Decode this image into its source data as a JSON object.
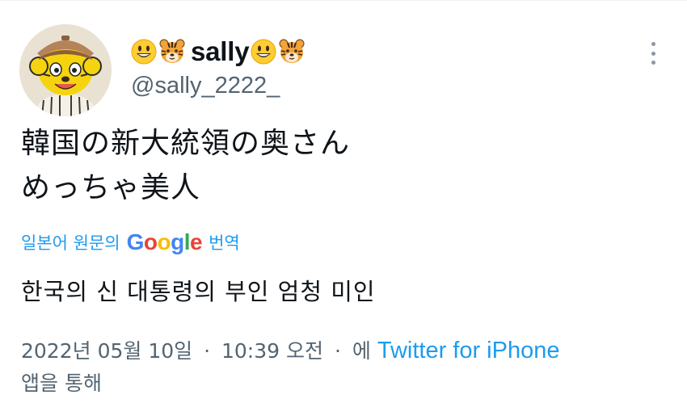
{
  "author": {
    "display_name": "sally",
    "handle": "@sally_2222_",
    "emoji_before": [
      "smiling-face-icon",
      "tiger-face-icon"
    ],
    "emoji_after": [
      "smiling-face-icon",
      "tiger-face-icon"
    ]
  },
  "tweet": {
    "lines": [
      "韓国の新大統領の奥さん",
      "めっちゃ美人"
    ]
  },
  "translation": {
    "prefix": "일본어 원문의",
    "google": [
      "G",
      "o",
      "o",
      "g",
      "l",
      "e"
    ],
    "suffix": "번역",
    "text": "한국의 신 대통령의 부인 엄청 미인"
  },
  "meta": {
    "date": "2022년 05월 10일",
    "separator": "·",
    "time": "10:39 오전",
    "via_prefix": "에",
    "source": "Twitter for iPhone",
    "via_suffix": "앱을 통해"
  },
  "colors": {
    "link": "#1d9bf0",
    "secondary_text": "#536471",
    "primary_text": "#0f1419",
    "google": [
      "#4285f4",
      "#ea4335",
      "#fbbc05",
      "#4285f4",
      "#34a853",
      "#ea4335"
    ]
  }
}
